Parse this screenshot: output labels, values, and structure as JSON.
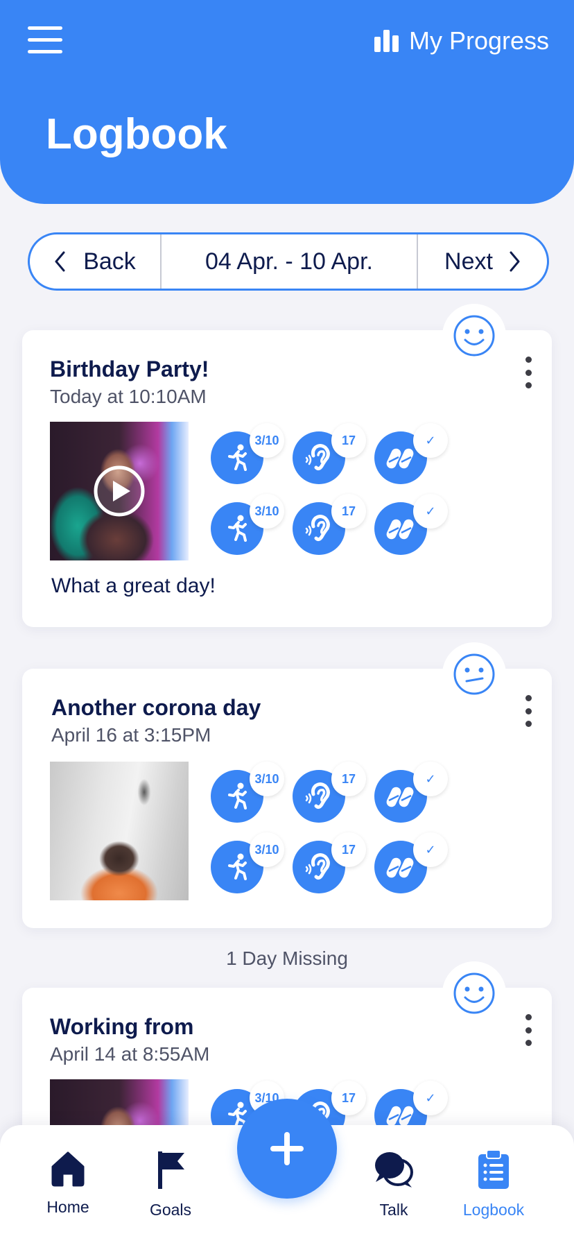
{
  "header": {
    "title": "Logbook",
    "progress_label": "My Progress",
    "menu_icon": "hamburger-icon",
    "progress_icon": "bar-chart-icon"
  },
  "week_nav": {
    "back_label": "Back",
    "range": "04 Apr. - 10 Apr.",
    "next_label": "Next"
  },
  "entries": [
    {
      "title": "Birthday Party!",
      "time": "Today at 10:10AM",
      "mood": "happy",
      "media": "video",
      "note": "What a great day!",
      "metrics": [
        {
          "icon": "running-icon",
          "value": "3/10"
        },
        {
          "icon": "hearing-icon",
          "value": "17"
        },
        {
          "icon": "pills-icon",
          "value": "✓"
        },
        {
          "icon": "running-icon",
          "value": "3/10"
        },
        {
          "icon": "hearing-icon",
          "value": "17"
        },
        {
          "icon": "pills-icon",
          "value": "✓"
        }
      ]
    },
    {
      "title": "Another corona day",
      "time": "April 16 at 3:15PM",
      "mood": "neutral",
      "media": "photo",
      "note": "",
      "metrics": [
        {
          "icon": "running-icon",
          "value": "3/10"
        },
        {
          "icon": "hearing-icon",
          "value": "17"
        },
        {
          "icon": "pills-icon",
          "value": "✓"
        },
        {
          "icon": "running-icon",
          "value": "3/10"
        },
        {
          "icon": "hearing-icon",
          "value": "17"
        },
        {
          "icon": "pills-icon",
          "value": "✓"
        }
      ]
    },
    {
      "title": "Working from",
      "time": "April 14 at 8:55AM",
      "mood": "happy",
      "media": "photo",
      "note": "",
      "metrics": [
        {
          "icon": "running-icon",
          "value": "3/10"
        },
        {
          "icon": "hearing-icon",
          "value": "17"
        },
        {
          "icon": "pills-icon",
          "value": "✓"
        }
      ]
    }
  ],
  "missing_label": "1 Day Missing",
  "bottom_nav": {
    "items": [
      {
        "label": "Home",
        "icon": "home-icon"
      },
      {
        "label": "Goals",
        "icon": "flag-icon"
      },
      {
        "label": "Talk",
        "icon": "chat-icon"
      },
      {
        "label": "Logbook",
        "icon": "clipboard-icon",
        "active": true
      }
    ],
    "fab_icon": "plus-icon"
  },
  "colors": {
    "primary": "#3985F5",
    "navy": "#0E1B4D",
    "background": "#F3F3F8"
  }
}
